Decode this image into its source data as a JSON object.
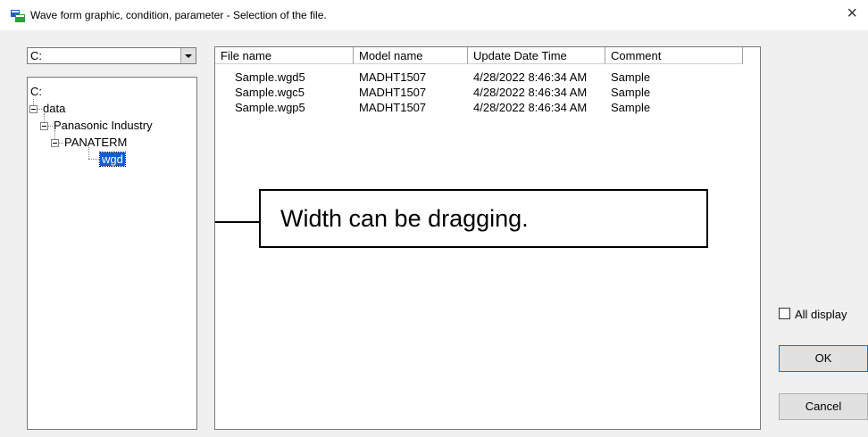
{
  "window": {
    "title": "Wave form graphic, condition, parameter - Selection of the file.",
    "icon": "app-window-icon",
    "close_glyph": "×"
  },
  "drive": {
    "selected": "C:"
  },
  "tree": {
    "root": "C:",
    "level1": "data",
    "level2": "Panasonic Industry",
    "level3": "PANATERM",
    "level4": "wgd"
  },
  "list": {
    "columns": [
      "File name",
      "Model name",
      "Update Date Time",
      "Comment"
    ],
    "rows": [
      [
        "Sample.wgd5",
        "MADHT1507",
        "4/28/2022 8:46:34 AM",
        "Sample"
      ],
      [
        "Sample.wgc5",
        "MADHT1507",
        "4/28/2022 8:46:34 AM",
        "Sample"
      ],
      [
        "Sample.wgp5",
        "MADHT1507",
        "4/28/2022 8:46:34 AM",
        "Sample"
      ]
    ]
  },
  "annotation": "Width can be dragging.",
  "options": {
    "all_display_label": "All display",
    "all_display_checked": false
  },
  "buttons": {
    "ok": "OK",
    "cancel": "Cancel"
  },
  "colors": {
    "selection": "#0a5fd8",
    "dialog_bg": "#f0f0f0"
  }
}
